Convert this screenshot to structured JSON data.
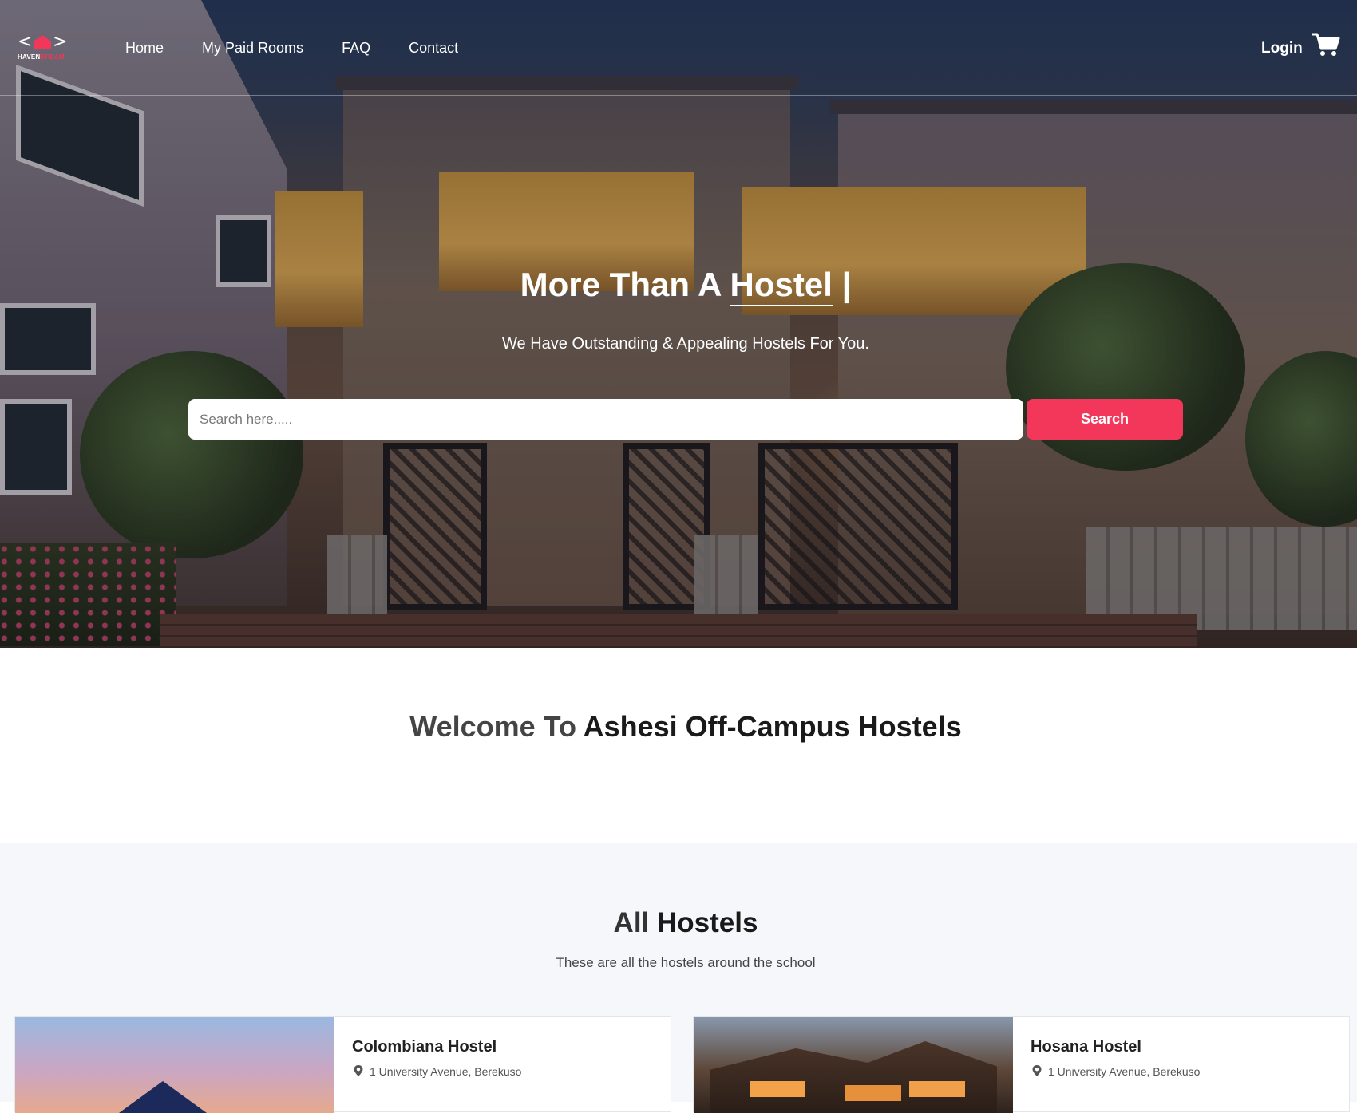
{
  "nav": {
    "logo_brand": "HAVEN",
    "logo_brand_accent": "DREAM",
    "links": [
      "Home",
      "My Paid Rooms",
      "FAQ",
      "Contact"
    ],
    "login": "Login",
    "cart_icon": "cart-icon"
  },
  "hero": {
    "title_prefix": "More Than A ",
    "title_typed": "Hostel",
    "title_cursor": " |",
    "subtitle": "We Have Outstanding & Appealing Hostels For You.",
    "search_placeholder": "Search here.....",
    "search_button": "Search"
  },
  "welcome": {
    "title_light": "Welcome To ",
    "title_bold": "Ashesi Off-Campus Hostels"
  },
  "hostels": {
    "title_light": "All ",
    "title_bold": "Hostels",
    "subtitle": "These are all the hostels around the school",
    "items": [
      {
        "name": "Colombiana Hostel",
        "address": "1 University Avenue, Berekuso"
      },
      {
        "name": "Hosana Hostel",
        "address": "1 University Avenue, Berekuso"
      }
    ]
  },
  "colors": {
    "accent": "#f2375a"
  }
}
